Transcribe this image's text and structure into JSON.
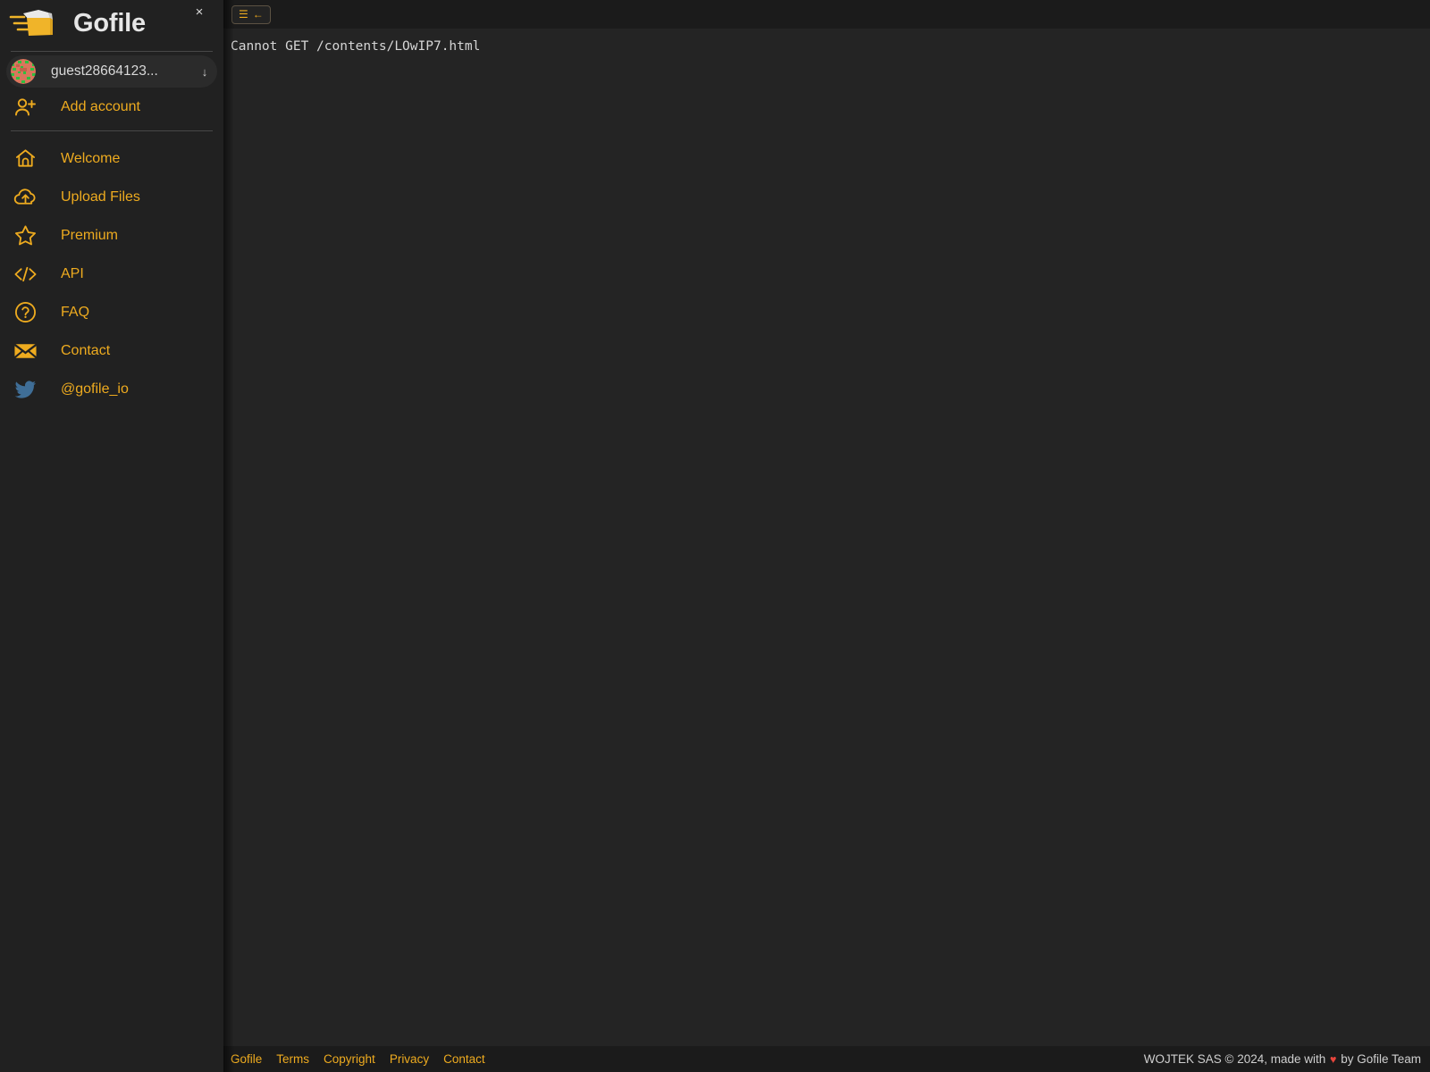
{
  "brand": {
    "title": "Gofile",
    "logo_icon": "gofile-folder-logo",
    "close_icon": "close-icon",
    "close_label": "×"
  },
  "sidebar": {
    "account": {
      "avatar_icon": "identicon-avatar",
      "name": "guest28664123...",
      "caret_icon": "chevron-down-icon",
      "caret_label": "↓"
    },
    "add_account": {
      "label": "Add account",
      "icon": "user-plus-icon"
    },
    "items": [
      {
        "label": "Welcome",
        "icon": "home-icon"
      },
      {
        "label": "Upload Files",
        "icon": "cloud-upload-icon"
      },
      {
        "label": "Premium",
        "icon": "star-icon"
      },
      {
        "label": "API",
        "icon": "code-brackets-icon"
      },
      {
        "label": "FAQ",
        "icon": "question-circle-icon"
      },
      {
        "label": "Contact",
        "icon": "envelope-icon"
      },
      {
        "label": "@gofile_io",
        "icon": "twitter-bird-icon"
      }
    ]
  },
  "topbar": {
    "menu_button": {
      "menu_icon": "hamburger-menu-icon",
      "menu_glyph": "☰",
      "back_icon": "arrow-left-icon",
      "back_glyph": "←"
    }
  },
  "main": {
    "error_message": "Cannot GET /contents/LOwIP7.html"
  },
  "footer": {
    "links": [
      {
        "label": "Gofile"
      },
      {
        "label": "Terms"
      },
      {
        "label": "Copyright"
      },
      {
        "label": "Privacy"
      },
      {
        "label": "Contact"
      }
    ],
    "copyright_prefix": "WOJTEK SAS © 2024, made with ",
    "heart_glyph": "♥",
    "copyright_suffix": " by Gofile Team"
  },
  "colors": {
    "accent": "#eeab1f",
    "sidebar_bg": "#212121",
    "main_bg": "#242424",
    "bar_bg": "#1b1b1b",
    "text": "#d9d9d9",
    "twitter_blue": "#3f6e97",
    "heart_red": "#e8453c"
  }
}
